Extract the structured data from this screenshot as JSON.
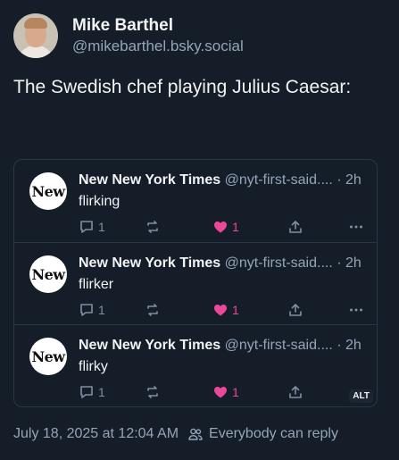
{
  "author": {
    "display_name": "Mike Barthel",
    "handle": "@mikebarthel.bsky.social"
  },
  "post": {
    "text": "The Swedish chef playing Julius Caesar:",
    "timestamp": "July 18, 2025 at 12:04 AM",
    "reply_setting": "Everybody can reply"
  },
  "embed": {
    "alt_badge": "ALT",
    "posts": [
      {
        "avatar_text": "New",
        "name": "New New York Times",
        "handle": "@nyt-first-said....",
        "time": "· 2h",
        "text": "flirking",
        "reply_count": "1",
        "like_count": "1"
      },
      {
        "avatar_text": "New",
        "name": "New New York Times",
        "handle": "@nyt-first-said....",
        "time": "· 2h",
        "text": "flirker",
        "reply_count": "1",
        "like_count": "1"
      },
      {
        "avatar_text": "New",
        "name": "New New York Times",
        "handle": "@nyt-first-said....",
        "time": "· 2h",
        "text": "flirky",
        "reply_count": "1",
        "like_count": "1"
      }
    ]
  },
  "colors": {
    "background": "#151d28",
    "text": "#f1f3f5",
    "muted": "#93a5b8",
    "like": "#ec4899",
    "border": "#2a3645"
  }
}
